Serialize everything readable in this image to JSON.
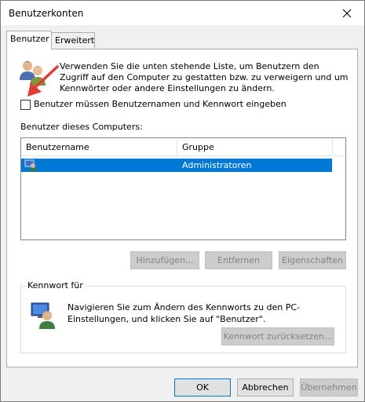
{
  "window": {
    "title": "Benutzerkonten",
    "close_glyph": "✕"
  },
  "tabs": [
    {
      "label": "Benutzer",
      "active": true
    },
    {
      "label": "Erweitert",
      "active": false
    }
  ],
  "users_tab": {
    "description": "Verwenden Sie die unten stehende Liste, um Benutzern den Zugriff auf den Computer zu gestatten bzw. zu verweigern und um Kennwörter oder andere Einstellungen zu ändern.",
    "checkbox_label": "Benutzer müssen Benutzernamen und Kennwort eingeben",
    "checkbox_checked": false,
    "list_section_label": "Benutzer dieses Computers:",
    "list_columns": [
      "Benutzername",
      "Gruppe"
    ],
    "list_rows": [
      {
        "username": "",
        "group": "Administratoren",
        "selected": true
      }
    ],
    "buttons": {
      "add": "Hinzufügen...",
      "remove": "Entfernen",
      "properties": "Eigenschaften"
    },
    "password_group": {
      "title": "Kennwort für",
      "text": "Navigieren Sie zum Ändern des Kennworts zu den PC-Einstellungen, und klicken Sie auf \"Benutzer\".",
      "reset_button": "Kennwort zurücksetzen..."
    }
  },
  "footer": {
    "ok": "OK",
    "cancel": "Abbrechen",
    "apply": "Übernehmen"
  },
  "colors": {
    "selection": "#0078d7",
    "annotation_arrow": "#e53935"
  },
  "icons": [
    "close-icon",
    "users-icon",
    "user-row-icon",
    "user-monitor-icon",
    "annotation-arrow-icon"
  ]
}
